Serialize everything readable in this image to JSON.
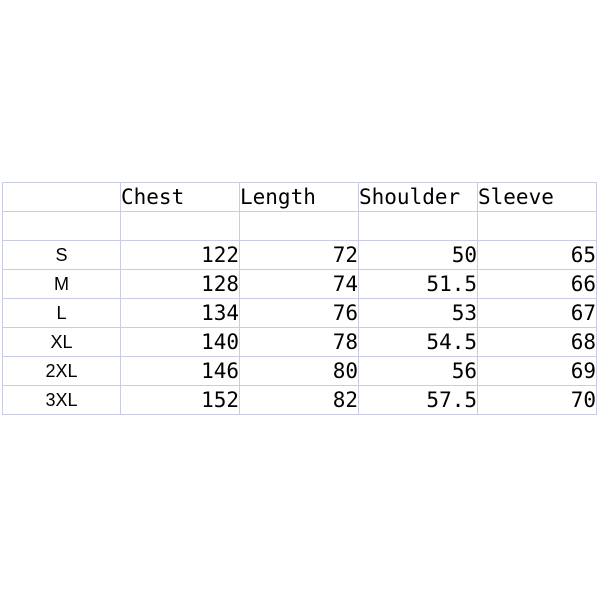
{
  "table": {
    "columns": [
      "",
      "Chest",
      "Length",
      "Shoulder",
      "Sleeve"
    ],
    "header": {
      "corner": "",
      "chest": "Chest",
      "length": "Length",
      "shoulder": "Shoulder",
      "sleeve": "Sleeve"
    },
    "spacer_row": [
      "",
      "",
      "",
      "",
      ""
    ],
    "rows": [
      {
        "size": "S",
        "chest": "122",
        "length": "72",
        "shoulder": "50",
        "sleeve": "65"
      },
      {
        "size": "M",
        "chest": "128",
        "length": "74",
        "shoulder": "51.5",
        "sleeve": "66"
      },
      {
        "size": "L",
        "chest": "134",
        "length": "76",
        "shoulder": "53",
        "sleeve": "67"
      },
      {
        "size": "XL",
        "chest": "140",
        "length": "78",
        "shoulder": "54.5",
        "sleeve": "68"
      },
      {
        "size": "2XL",
        "chest": "146",
        "length": "80",
        "shoulder": "56",
        "sleeve": "69"
      },
      {
        "size": "3XL",
        "chest": "152",
        "length": "82",
        "shoulder": "57.5",
        "sleeve": "70"
      }
    ]
  },
  "chart_data": {
    "type": "table",
    "title": "",
    "categories": [
      "S",
      "M",
      "L",
      "XL",
      "2XL",
      "3XL"
    ],
    "columns": [
      "Chest",
      "Length",
      "Shoulder",
      "Sleeve"
    ],
    "series": [
      {
        "name": "Chest",
        "values": [
          122,
          128,
          134,
          140,
          146,
          152
        ]
      },
      {
        "name": "Length",
        "values": [
          72,
          74,
          76,
          78,
          80,
          82
        ]
      },
      {
        "name": "Shoulder",
        "values": [
          50,
          51.5,
          53,
          54.5,
          56,
          57.5
        ]
      },
      {
        "name": "Sleeve",
        "values": [
          65,
          66,
          67,
          68,
          69,
          70
        ]
      }
    ],
    "xlabel": "",
    "ylabel": "",
    "grid": true,
    "legend": "none"
  },
  "style": {
    "grid_line_color": "#c8cce4",
    "text_color": "#000000",
    "background": "#ffffff"
  }
}
